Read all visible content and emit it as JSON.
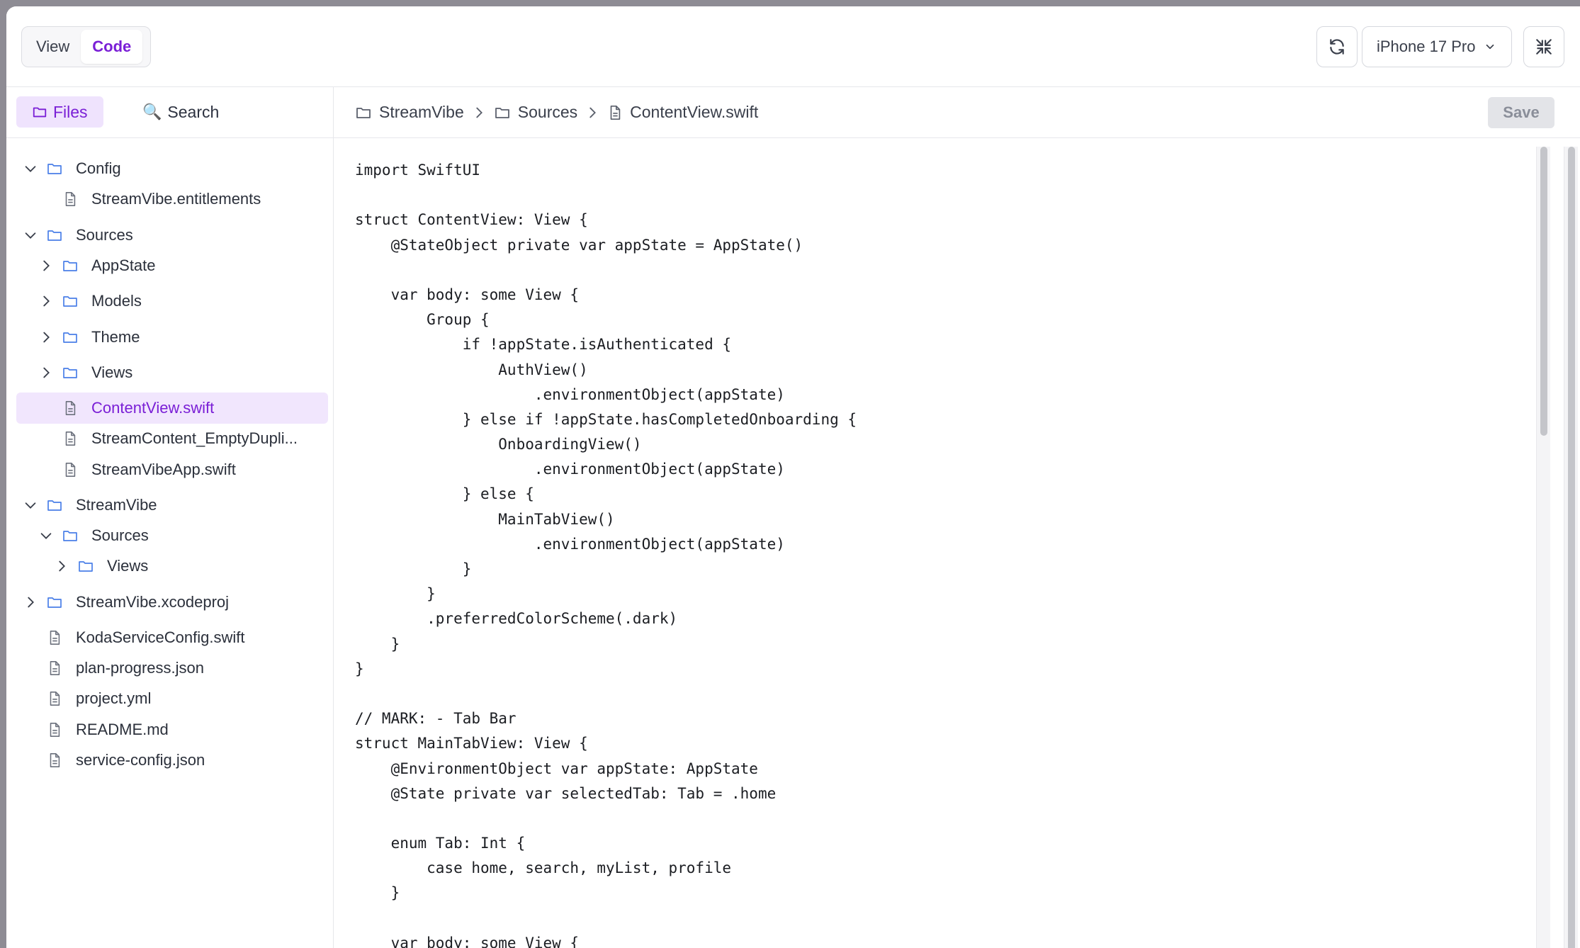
{
  "topbar": {
    "view_label": "View",
    "code_label": "Code",
    "device_label": "iPhone 17 Pro"
  },
  "sidebar": {
    "files_label": "Files",
    "search_label": "Search",
    "tree": [
      {
        "label": "Config",
        "type": "folder",
        "expanded": true
      },
      {
        "label": "StreamVibe.entitlements",
        "type": "file"
      },
      {
        "label": "Sources",
        "type": "folder",
        "expanded": true
      },
      {
        "label": "AppState",
        "type": "folder",
        "expanded": false
      },
      {
        "label": "Models",
        "type": "folder",
        "expanded": false
      },
      {
        "label": "Theme",
        "type": "folder",
        "expanded": false
      },
      {
        "label": "Views",
        "type": "folder",
        "expanded": false
      },
      {
        "label": "ContentView.swift",
        "type": "file",
        "selected": true
      },
      {
        "label": "StreamContent_EmptyDupli...",
        "type": "file"
      },
      {
        "label": "StreamVibeApp.swift",
        "type": "file"
      },
      {
        "label": "StreamVibe",
        "type": "folder",
        "expanded": true
      },
      {
        "label": "Sources",
        "type": "folder",
        "expanded": true
      },
      {
        "label": "Views",
        "type": "folder",
        "expanded": false
      },
      {
        "label": "StreamVibe.xcodeproj",
        "type": "folder",
        "expanded": false
      },
      {
        "label": "KodaServiceConfig.swift",
        "type": "file"
      },
      {
        "label": "plan-progress.json",
        "type": "file"
      },
      {
        "label": "project.yml",
        "type": "file"
      },
      {
        "label": "README.md",
        "type": "file"
      },
      {
        "label": "service-config.json",
        "type": "file"
      }
    ]
  },
  "editor": {
    "breadcrumb": [
      "StreamVibe",
      "Sources",
      "ContentView.swift"
    ],
    "save_label": "Save",
    "code_lines": [
      "import SwiftUI",
      "",
      "struct ContentView: View {",
      "    @StateObject private var appState = AppState()",
      "",
      "    var body: some View {",
      "        Group {",
      "            if !appState.isAuthenticated {",
      "                AuthView()",
      "                    .environmentObject(appState)",
      "            } else if !appState.hasCompletedOnboarding {",
      "                OnboardingView()",
      "                    .environmentObject(appState)",
      "            } else {",
      "                MainTabView()",
      "                    .environmentObject(appState)",
      "            }",
      "        }",
      "        .preferredColorScheme(.dark)",
      "    }",
      "}",
      "",
      "// MARK: - Tab Bar",
      "struct MainTabView: View {",
      "    @EnvironmentObject var appState: AppState",
      "    @State private var selectedTab: Tab = .home",
      "",
      "    enum Tab: Int {",
      "        case home, search, myList, profile",
      "    }",
      "",
      "    var body: some View {"
    ]
  },
  "colors": {
    "accent": "#7a1fd6",
    "accent_bg": "#efe3fd",
    "folder_icon": "#4a7fe8"
  }
}
